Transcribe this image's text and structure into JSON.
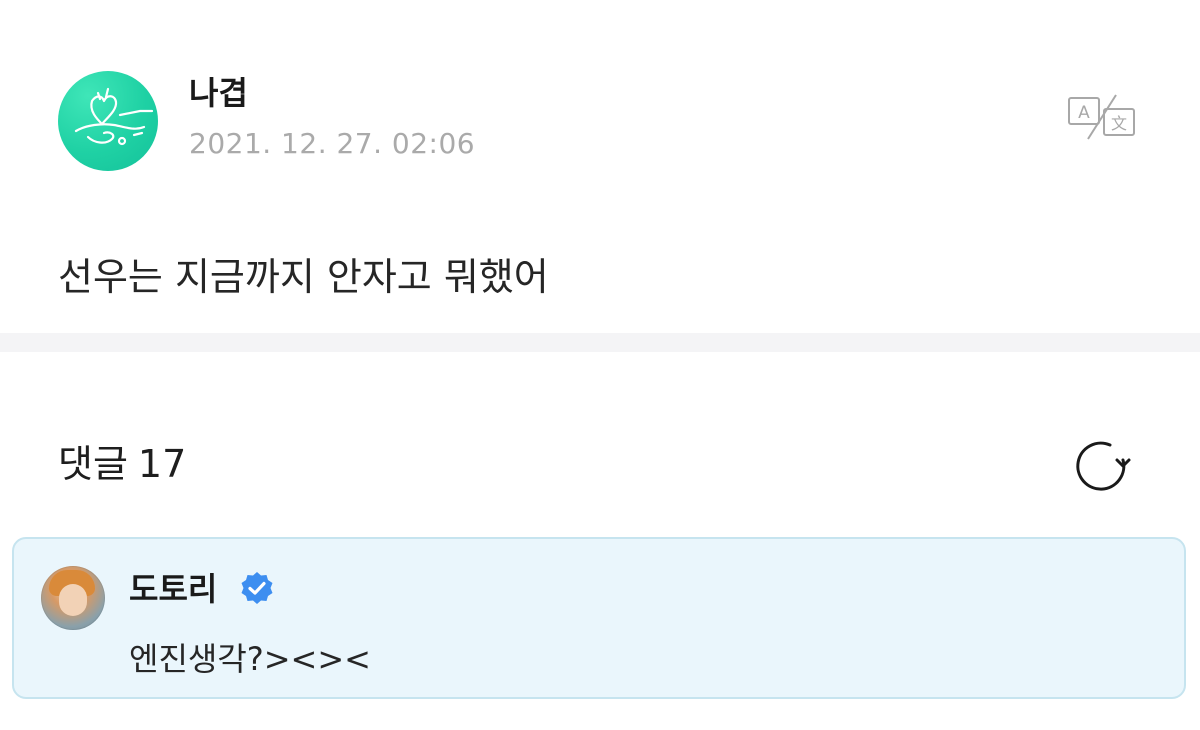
{
  "post": {
    "author": "나겹",
    "timestamp": "2021. 12. 27. 02:06",
    "body": "선우는 지금까지 안자고 뭐했어",
    "avatar_icon": "heart-signature-icon",
    "translate_icon": "translate-icon"
  },
  "comments": {
    "label": "댓글",
    "count": "17",
    "refresh_icon": "refresh-icon",
    "items": [
      {
        "author": "도토리",
        "verified": true,
        "text": "엔진생각?><><"
      }
    ]
  },
  "colors": {
    "accent": "#1fd1a4",
    "card_bg": "#eaf6fc",
    "card_border": "#c6e4ef",
    "verified": "#3d8ef0",
    "muted_text": "#aaaaaa"
  }
}
